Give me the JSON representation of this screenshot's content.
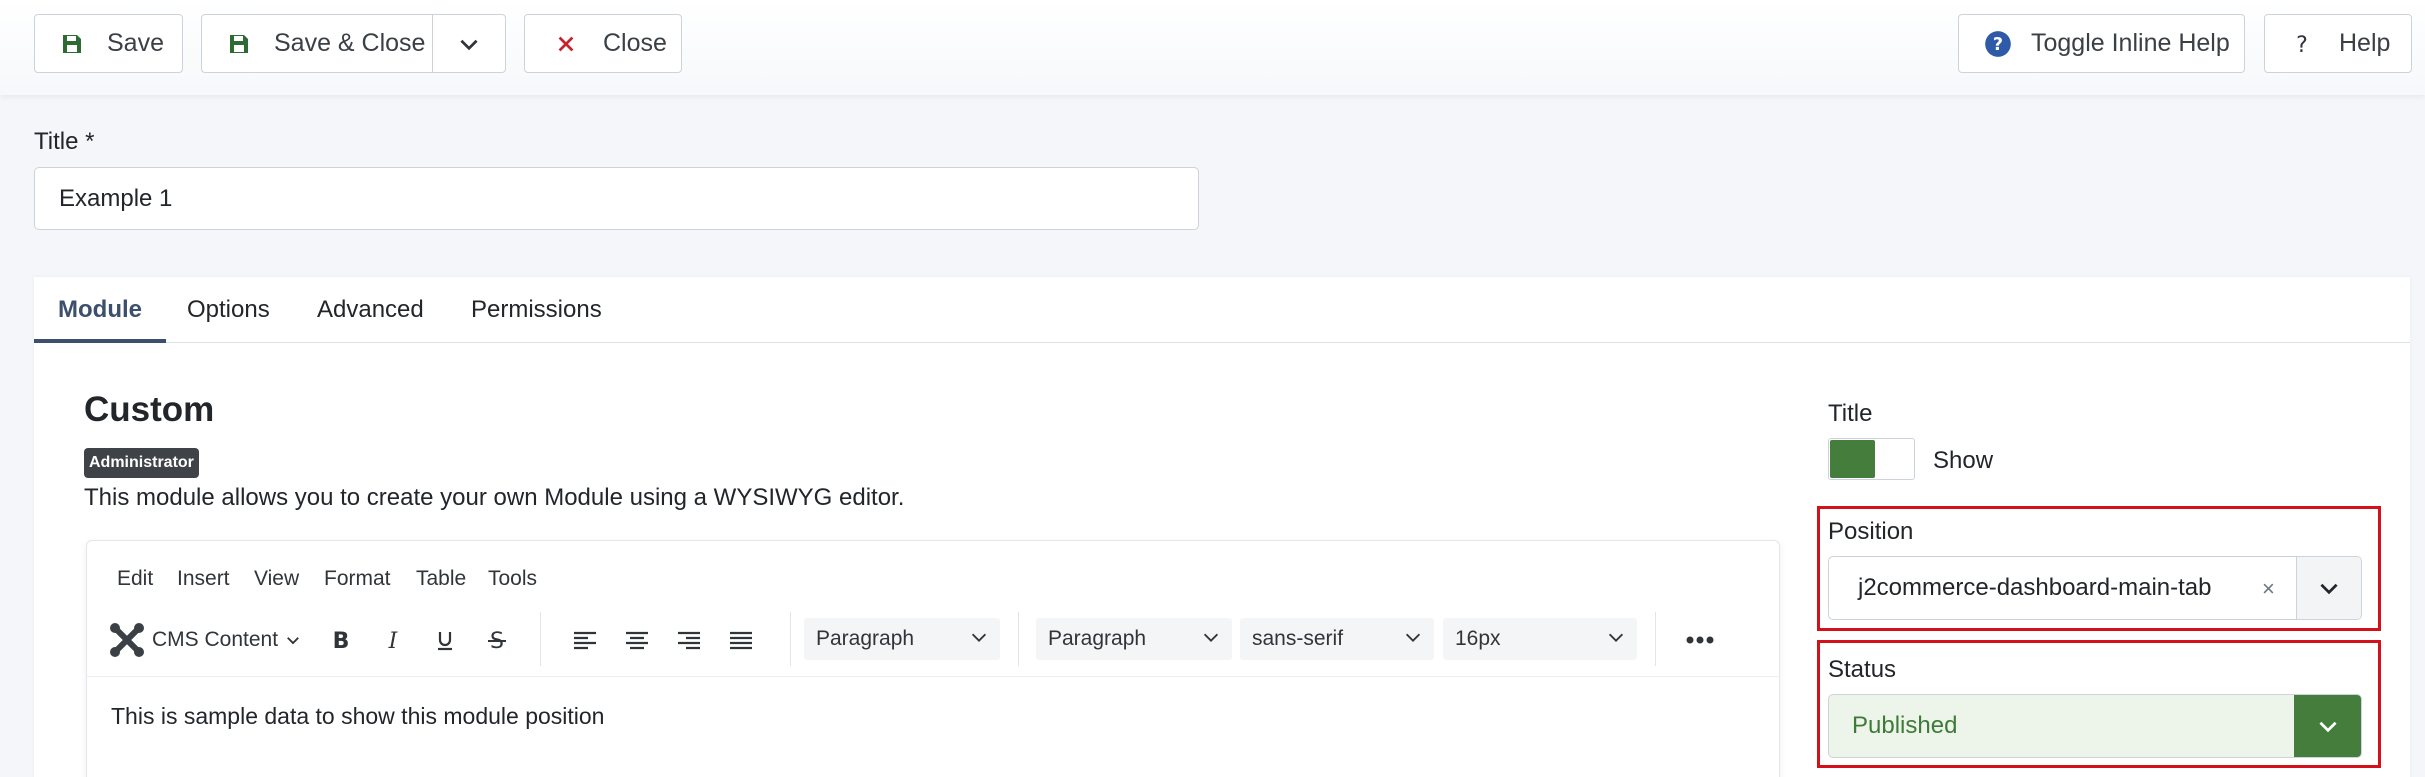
{
  "toolbar": {
    "save_label": "Save",
    "save_close_label": "Save & Close",
    "close_label": "Close",
    "toggle_help_label": "Toggle Inline Help",
    "help_label": "Help"
  },
  "form": {
    "title_label": "Title *",
    "title_value": "Example 1"
  },
  "tabs": [
    {
      "label": "Module",
      "active": true
    },
    {
      "label": "Options",
      "active": false
    },
    {
      "label": "Advanced",
      "active": false
    },
    {
      "label": "Permissions",
      "active": false
    }
  ],
  "module": {
    "heading": "Custom",
    "badge": "Administrator",
    "description": "This module allows you to create your own Module using a WYSIWYG editor."
  },
  "editor": {
    "menu": [
      "Edit",
      "Insert",
      "View",
      "Format",
      "Table",
      "Tools"
    ],
    "cms_content_label": "CMS Content",
    "block_format_1": "Paragraph",
    "block_format_2": "Paragraph",
    "font_family": "sans-serif",
    "font_size": "16px",
    "content": "This is sample data to show this module position"
  },
  "sidebar": {
    "title_label": "Title",
    "title_toggle_value": "Show",
    "position_label": "Position",
    "position_value": "j2commerce-dashboard-main-tab",
    "position_clear": "×",
    "status_label": "Status",
    "status_value": "Published"
  },
  "colors": {
    "accent_green": "#457d3c",
    "highlight_red": "#d3111b",
    "tab_active": "#3c4f6c",
    "close_icon": "#c5222a",
    "help_icon": "#2e5aa8"
  },
  "icons": {
    "save": "floppy-disk-icon",
    "save_close": "floppy-disk-icon",
    "dropdown": "chevron-down-icon",
    "close": "x-mark-icon",
    "toggle_help": "question-circle-icon",
    "help": "question-mark-icon",
    "joomla": "joomla-logo-icon"
  }
}
